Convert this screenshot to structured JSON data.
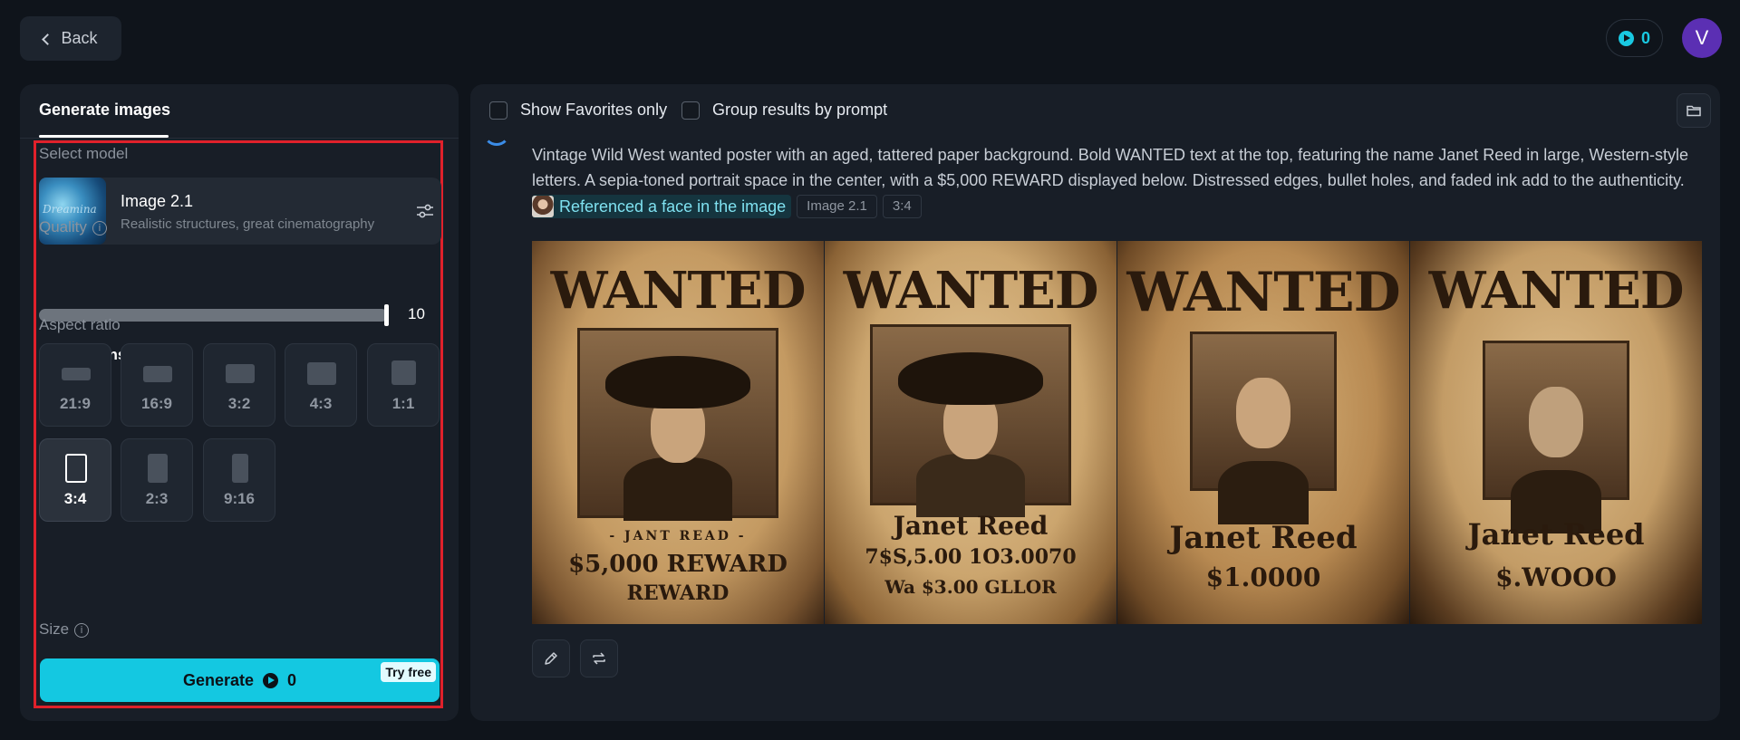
{
  "topbar": {
    "back_label": "Back",
    "credits": "0",
    "avatar_initial": "V"
  },
  "left": {
    "tab": "Generate images",
    "select_model_label": "Select model",
    "model": {
      "name": "Image 2.1",
      "description": "Realistic structures, great cinematography",
      "thumb_text": "Dreamina"
    },
    "quality_label": "Quality",
    "quality_value": "10",
    "quality_level_fraction": 1.0,
    "dimensions_label": "Dimensions",
    "aspect_ratio_label": "Aspect ratio",
    "aspect_ratios": [
      "21:9",
      "16:9",
      "3:2",
      "4:3",
      "1:1",
      "3:4",
      "2:3",
      "9:16"
    ],
    "selected_ratio": "3:4",
    "size_label": "Size",
    "generate_label": "Generate",
    "generate_cost": "0",
    "try_free_label": "Try free"
  },
  "right": {
    "show_favorites_label": "Show Favorites only",
    "group_results_label": "Group results by prompt",
    "prompt_text": "Vintage Wild West wanted poster with an aged, tattered paper background. Bold WANTED text at the top, featuring the name Janet Reed in large, Western-style letters. A sepia-toned portrait space in the center, with a $5,000 REWARD displayed below. Distressed edges, bullet holes, and faded ink add to the authenticity.",
    "reference_label": "Referenced a face in the image",
    "model_tag": "Image 2.1",
    "ratio_tag": "3:4",
    "results": [
      {
        "wanted": "WANTED",
        "line1": "- JANT READ -",
        "line2": "$5,000 REWARD",
        "line3": "REWARD"
      },
      {
        "wanted": "WANTED",
        "line1": "Janet Reed",
        "line2": "7$S,5.00 1O3.0070",
        "line3": "Wa $3.00 GLLOR"
      },
      {
        "wanted": "WANTED",
        "line1": "Janet Reed",
        "line2": "$1.0000",
        "line3": ""
      },
      {
        "wanted": "WANTED",
        "line1": "Janet Reed",
        "line2": "$.WOOO",
        "line3": ""
      }
    ]
  },
  "colors": {
    "accent": "#14c8e1",
    "highlight_frame": "#e0212b",
    "avatar": "#5b2fb3"
  }
}
